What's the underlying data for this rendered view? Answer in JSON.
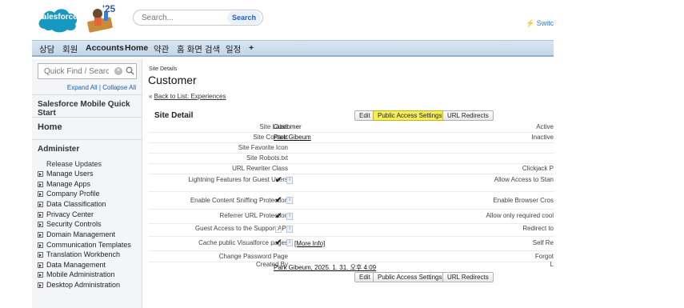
{
  "header": {
    "logo_text": "salesforce",
    "mascot_year": "'25",
    "search_placeholder": "Search...",
    "search_button": "Search",
    "switch_label": "Switch"
  },
  "tabs": [
    {
      "label": "상담"
    },
    {
      "label": "회원"
    },
    {
      "label": "Accounts"
    },
    {
      "label": "Home"
    },
    {
      "label": "약관"
    },
    {
      "label": "홈 화면 검색"
    },
    {
      "label": "일정"
    },
    {
      "label": "+"
    }
  ],
  "sidebar": {
    "quick_find_placeholder": "Quick Find / Search...",
    "expand_collapse": "Expand All | Collapse All",
    "mobile_quick_start": "Salesforce Mobile Quick Start",
    "home": "Home",
    "administer": "Administer",
    "release_updates": "Release Updates",
    "items": [
      "Manage Users",
      "Manage Apps",
      "Company Profile",
      "Data Classification",
      "Privacy Center",
      "Security Controls",
      "Domain Management",
      "Communication Templates",
      "Translation Workbench",
      "Data Management",
      "Mobile Administration",
      "Desktop Administration"
    ]
  },
  "content": {
    "breadcrumb": "Site Details",
    "title": "Customer",
    "back_link_prefix": "« ",
    "back_link": "Back to List: Experiences",
    "section_title": "Site Detail",
    "buttons": {
      "edit": "Edit",
      "public_access": "Public Access Settings",
      "url_redirects": "URL Redirects"
    },
    "rows": [
      {
        "label": "Site Label",
        "value": "Customer",
        "right": "Active"
      },
      {
        "label": "Site Contact",
        "value": "Park Gibeum",
        "right": "Inactive"
      },
      {
        "label": "Site Favorite Icon",
        "value": "",
        "right": ""
      },
      {
        "label": "Site Robots.txt",
        "value": "",
        "right": ""
      },
      {
        "label": "URL Rewriter Class",
        "value": "",
        "right": "Clickjack P"
      },
      {
        "label": "Lightning Features for Guest Users",
        "value": "",
        "right": "Allow Access to Stan"
      },
      {
        "label": "Enable Content Sniffing Protection",
        "value": "",
        "right": "Enable Browser Cros"
      },
      {
        "label": "Referrer URL Protection",
        "value": "",
        "right": "Allow only required cool"
      },
      {
        "label": "Guest Access to the Support API",
        "value": "",
        "right": "Redirect to"
      },
      {
        "label": "Cache public Visualforce pages",
        "value": "",
        "right": "Self Re"
      },
      {
        "label": "Change Password Page",
        "value": "",
        "right": "Forgot"
      },
      {
        "label": "Created By",
        "value": "Park Gibeum, 2025. 1. 31. 오후 4:09",
        "right": "L"
      }
    ],
    "check_mark": "✔",
    "info_glyph": "i",
    "more_info": "[More Info]"
  }
}
